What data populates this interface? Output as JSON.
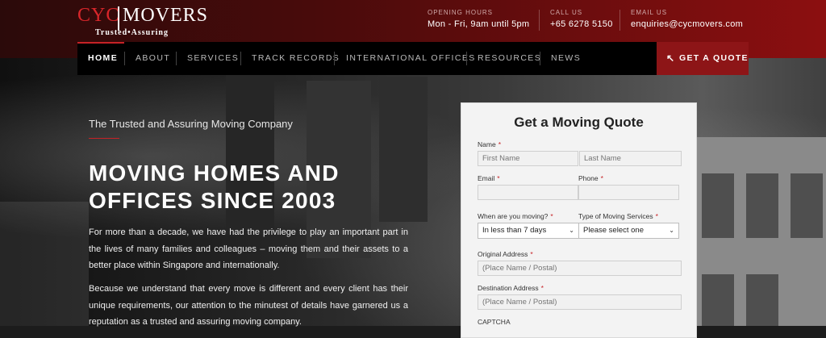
{
  "brand": {
    "logo_left": "CYC",
    "logo_right": "MOVERS",
    "tagline": "Trusted•Assuring"
  },
  "contact": [
    {
      "label": "OPENING HOURS",
      "value": "Mon - Fri, 9am until 5pm"
    },
    {
      "label": "CALL US",
      "value": "+65 6278 5150"
    },
    {
      "label": "EMAIL US",
      "value": "enquiries@cycmovers.com"
    }
  ],
  "nav": {
    "items": [
      {
        "label": "HOME",
        "active": true
      },
      {
        "label": "ABOUT"
      },
      {
        "label": "SERVICES"
      },
      {
        "label": "TRACK RECORDS"
      },
      {
        "label": "INTERNATIONAL OFFICES"
      },
      {
        "label": "RESOURCES"
      },
      {
        "label": "NEWS"
      }
    ],
    "cta": {
      "label": "GET A QUOTE",
      "icon": "cursor-icon"
    }
  },
  "hero": {
    "subtitle": "The Trusted and Assuring Moving Company",
    "headline": "MOVING HOMES AND OFFICES SINCE 2003",
    "paragraph1": "For more than a decade, we have had the privilege to play an important part in the lives of many families and colleagues – moving them and their assets to a better place within Singapore and internationally.",
    "paragraph2": "Because we understand that every move is different and every client has their unique requirements, our attention to the minutest of details have garnered us a reputation as a trusted and assuring moving company."
  },
  "form": {
    "title": "Get a Moving Quote",
    "name_label": "Name",
    "first_name_placeholder": "First Name",
    "last_name_placeholder": "Last Name",
    "email_label": "Email",
    "phone_label": "Phone",
    "when_label": "When are you moving?",
    "when_value": "In less than 7 days",
    "type_label": "Type of Moving Services",
    "type_value": "Please select one",
    "origin_label": "Original Address",
    "origin_placeholder": "(Place Name / Postal)",
    "dest_label": "Destination Address",
    "dest_placeholder": "(Place Name / Postal)",
    "captcha_label": "CAPTCHA",
    "required_mark": "*"
  },
  "colors": {
    "accent": "#c62226",
    "cta": "#8d1517",
    "topbar": "#6b0d0e"
  }
}
